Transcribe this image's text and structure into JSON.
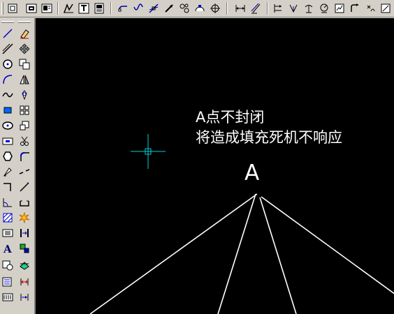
{
  "toolbar": {
    "items": [
      {
        "name": "zoom-window-icon"
      },
      {
        "name": "zoom-extents-icon"
      },
      {
        "name": "properties-icon"
      },
      {
        "name": "dimension-style-icon"
      },
      {
        "name": "text-style-icon"
      },
      {
        "name": "plot-icon"
      },
      {
        "name": "snap-endpoint-icon"
      },
      {
        "name": "snap-midpoint-icon"
      },
      {
        "name": "snap-intersection-icon"
      },
      {
        "name": "snap-extension-icon"
      },
      {
        "name": "snap-center-icon"
      },
      {
        "name": "snap-quadrant-icon"
      },
      {
        "name": "snap-tangent-icon"
      },
      {
        "name": "linear-dimension-icon"
      },
      {
        "name": "aligned-dimension-icon"
      },
      {
        "name": "ordinate-dimension-icon"
      },
      {
        "name": "radius-dimension-icon"
      },
      {
        "name": "diameter-dimension-icon"
      },
      {
        "name": "angular-dimension-icon"
      },
      {
        "name": "quick-dimension-icon"
      },
      {
        "name": "baseline-dimension-icon"
      }
    ]
  },
  "draw_toolbar": {
    "items": [
      "line-icon",
      "construction-line-icon",
      "circle-icon",
      "arc-icon",
      "spline-icon",
      "region-icon",
      "ellipse-icon",
      "insert-block-icon",
      "polygon-icon",
      "revision-cloud-icon",
      "polyline-icon",
      "dimension-angle-icon",
      "hatch-icon",
      "table-icon",
      "multiline-text-icon",
      "make-block-icon",
      "point-icon",
      "gradient-icon"
    ]
  },
  "modify_toolbar": {
    "items": [
      "erase-icon",
      "move-icon",
      "copy-icon",
      "mirror-icon",
      "rotate-icon",
      "array-icon",
      "scale-icon",
      "trim-icon",
      "fillet-icon",
      "break-icon",
      "extend-icon",
      "chamfer-icon",
      "explode-icon",
      "join-icon",
      "stretch-icon",
      "offset-icon",
      "lengthen-icon",
      "draw-order-icon"
    ]
  },
  "canvas": {
    "background": "#000000",
    "line_color": "#ffffff",
    "cursor_color": "#00d0d0",
    "note_line1": "A点不封闭",
    "note_line2": "将造成填充死机不响应",
    "point_label": "A"
  }
}
